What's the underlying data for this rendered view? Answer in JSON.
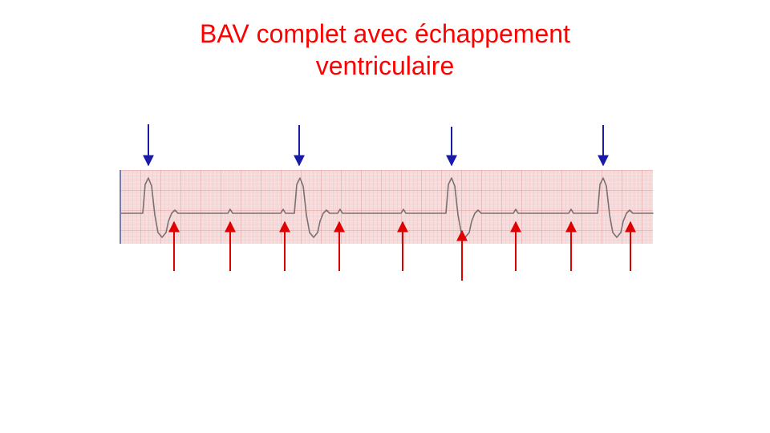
{
  "slide": {
    "title_line1": "BAV complet avec échappement",
    "title_line2": "ventriculaire"
  },
  "colors": {
    "title": "#ff0000",
    "qrs_arrows": "#1a1aa8",
    "p_wave_arrows": "#e00000",
    "ecg_paper_background": "#f6dede",
    "ecg_grid_minor": "#f0b8b8",
    "ecg_grid_major": "#e39a9a",
    "ecg_trace": "#7a7070"
  },
  "figure": {
    "type": "ecg-rhythm-strip",
    "qrs_arrow_count": 4,
    "p_wave_arrow_count": 9
  }
}
